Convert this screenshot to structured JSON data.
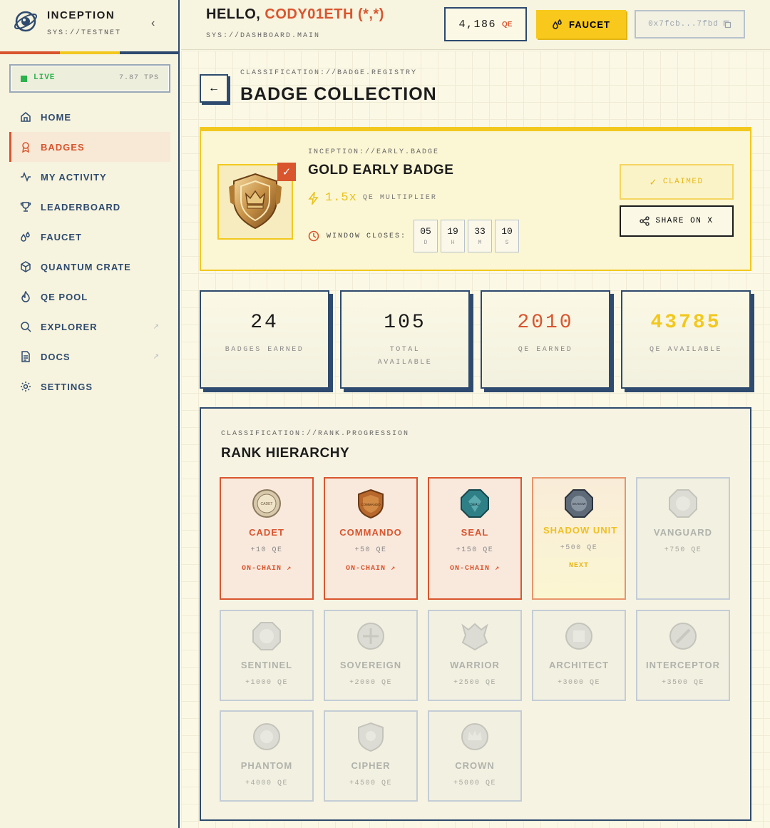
{
  "app": {
    "name": "INCEPTION",
    "sub": "SYS://TESTNET"
  },
  "status": {
    "label": "LIVE",
    "tps": "7.87 TPS"
  },
  "nav": [
    {
      "label": "HOME",
      "icon": "home-icon"
    },
    {
      "label": "BADGES",
      "icon": "badge-icon",
      "active": true
    },
    {
      "label": "MY ACTIVITY",
      "icon": "activity-icon"
    },
    {
      "label": "LEADERBOARD",
      "icon": "trophy-icon"
    },
    {
      "label": "FAUCET",
      "icon": "droplets-icon"
    },
    {
      "label": "QUANTUM CRATE",
      "icon": "box-icon"
    },
    {
      "label": "QE POOL",
      "icon": "flame-icon"
    },
    {
      "label": "EXPLORER",
      "icon": "search-icon",
      "external": true
    },
    {
      "label": "DOCS",
      "icon": "document-icon",
      "external": true
    },
    {
      "label": "SETTINGS",
      "icon": "gear-icon"
    }
  ],
  "header": {
    "hello": "HELLO,",
    "user": "CODY01ETH (*,*)",
    "sub": "SYS://DASHBOARD.MAIN",
    "balance": "4,186",
    "balance_unit": "QE",
    "faucet_label": "FAUCET",
    "wallet": "0x7fcb...7fbd"
  },
  "page": {
    "crumb": "CLASSIFICATION://BADGE.REGISTRY",
    "title": "BADGE COLLECTION"
  },
  "badge": {
    "crumb": "INCEPTION://EARLY.BADGE",
    "title": "GOLD EARLY BADGE",
    "multiplier": "1.5x",
    "multiplier_label": "QE MULTIPLIER",
    "window_label": "WINDOW CLOSES:",
    "countdown": [
      {
        "n": "05",
        "u": "D"
      },
      {
        "n": "19",
        "u": "H"
      },
      {
        "n": "33",
        "u": "M"
      },
      {
        "n": "10",
        "u": "S"
      }
    ],
    "claimed_label": "CLAIMED",
    "share_label": "SHARE ON X"
  },
  "stats": [
    {
      "value": "24",
      "label": "BADGES EARNED",
      "color": "#1c1c1c"
    },
    {
      "value": "105",
      "label": "TOTAL AVAILABLE",
      "color": "#1c1c1c"
    },
    {
      "value": "2010",
      "label": "QE EARNED",
      "color": "#d9552e"
    },
    {
      "value": "43785",
      "label": "QE AVAILABLE",
      "color": "#f2c81e"
    }
  ],
  "ranks": {
    "crumb": "CLASSIFICATION://RANK.PROGRESSION",
    "title": "RANK HIERARCHY",
    "items": [
      {
        "name": "CADET",
        "qe": "+10 QE",
        "state": "claimed",
        "chain": "ON-CHAIN",
        "color": "#c9b79a",
        "emblem_text": "CADET"
      },
      {
        "name": "COMMANDO",
        "qe": "+50 QE",
        "state": "claimed",
        "chain": "ON-CHAIN",
        "color": "#b0642c",
        "emblem_text": "COMMANDO"
      },
      {
        "name": "SEAL",
        "qe": "+150 QE",
        "state": "claimed",
        "chain": "ON-CHAIN",
        "color": "#2f7f86",
        "emblem_text": "SEAL"
      },
      {
        "name": "SHADOW UNIT",
        "qe": "+500 QE",
        "state": "next",
        "next": "NEXT",
        "color": "#5e6a78",
        "emblem_text": "SHADOW UNIT"
      },
      {
        "name": "VANGUARD",
        "qe": "+750 QE",
        "state": "locked",
        "color": "#d0d0c8"
      },
      {
        "name": "SENTINEL",
        "qe": "+1000 QE",
        "state": "locked",
        "color": "#d0d0c8"
      },
      {
        "name": "SOVEREIGN",
        "qe": "+2000 QE",
        "state": "locked",
        "color": "#d0d0c8"
      },
      {
        "name": "WARRIOR",
        "qe": "+2500 QE",
        "state": "locked",
        "color": "#d0d0c8"
      },
      {
        "name": "ARCHITECT",
        "qe": "+3000 QE",
        "state": "locked",
        "color": "#d0d0c8"
      },
      {
        "name": "INTERCEPTOR",
        "qe": "+3500 QE",
        "state": "locked",
        "color": "#d0d0c8"
      },
      {
        "name": "PHANTOM",
        "qe": "+4000 QE",
        "state": "locked",
        "color": "#d0d0c8"
      },
      {
        "name": "CIPHER",
        "qe": "+4500 QE",
        "state": "locked",
        "color": "#d0d0c8"
      },
      {
        "name": "CROWN",
        "qe": "+5000 QE",
        "state": "locked",
        "color": "#d0d0c8"
      }
    ]
  },
  "colors": {
    "accent": "#d9552e",
    "gold": "#f2c81e",
    "navy": "#2e4a6e",
    "live": "#2bb24c"
  }
}
